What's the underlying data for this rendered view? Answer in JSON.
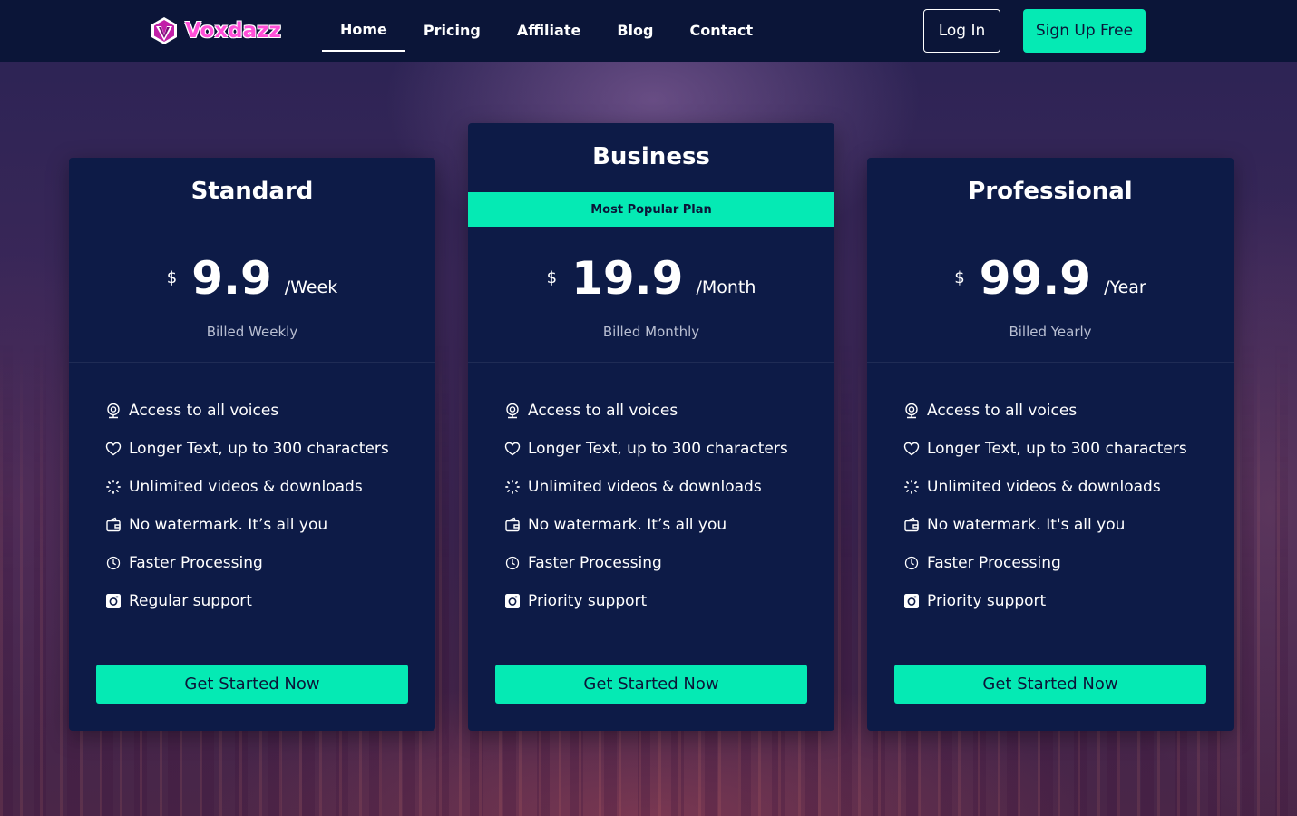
{
  "brand": {
    "name": "Voxdazz",
    "logo_color": "#ff4fd8"
  },
  "nav": {
    "items": [
      {
        "label": "Home",
        "active": true
      },
      {
        "label": "Pricing",
        "active": false
      },
      {
        "label": "Affiliate",
        "active": false
      },
      {
        "label": "Blog",
        "active": false
      },
      {
        "label": "Contact",
        "active": false
      }
    ]
  },
  "header": {
    "login_label": "Log In",
    "signup_label": "Sign Up Free"
  },
  "colors": {
    "accent": "#05eab4",
    "header_bg": "#0b1538",
    "card_bg": "#0d1b47"
  },
  "plans": [
    {
      "name": "Standard",
      "currency": "$",
      "amount": "9.9",
      "period": "/Week",
      "billed": "Billed Weekly",
      "features": [
        {
          "icon": "voice-icon",
          "text": "Access to all voices"
        },
        {
          "icon": "heart-icon",
          "text": "Longer Text, up to 300 characters"
        },
        {
          "icon": "loading-icon",
          "text": "Unlimited videos & downloads"
        },
        {
          "icon": "wallet-icon",
          "text": "No watermark. It’s all you"
        },
        {
          "icon": "clock-icon",
          "text": "Faster Processing"
        },
        {
          "icon": "camera-icon",
          "text": "Regular support"
        }
      ],
      "cta": "Get Started Now"
    },
    {
      "name": "Business",
      "badge": "Most Popular Plan",
      "currency": "$",
      "amount": "19.9",
      "period": "/Month",
      "billed": "Billed Monthly",
      "features": [
        {
          "icon": "voice-icon",
          "text": "Access to all voices"
        },
        {
          "icon": "heart-icon",
          "text": "Longer Text, up to 300 characters"
        },
        {
          "icon": "loading-icon",
          "text": "Unlimited videos & downloads"
        },
        {
          "icon": "wallet-icon",
          "text": "No watermark. It’s all you"
        },
        {
          "icon": "clock-icon",
          "text": "Faster Processing"
        },
        {
          "icon": "camera-icon",
          "text": "Priority support"
        }
      ],
      "cta": "Get Started Now"
    },
    {
      "name": "Professional",
      "currency": "$",
      "amount": "99.9",
      "period": "/Year",
      "billed": "Billed Yearly",
      "features": [
        {
          "icon": "voice-icon",
          "text": "Access to all voices"
        },
        {
          "icon": "heart-icon",
          "text": "Longer Text, up to 300 characters"
        },
        {
          "icon": "loading-icon",
          "text": "Unlimited videos & downloads"
        },
        {
          "icon": "wallet-icon",
          "text": "No watermark. It's all you"
        },
        {
          "icon": "clock-icon",
          "text": "Faster Processing"
        },
        {
          "icon": "camera-icon",
          "text": "Priority support"
        }
      ],
      "cta": "Get Started Now"
    }
  ]
}
